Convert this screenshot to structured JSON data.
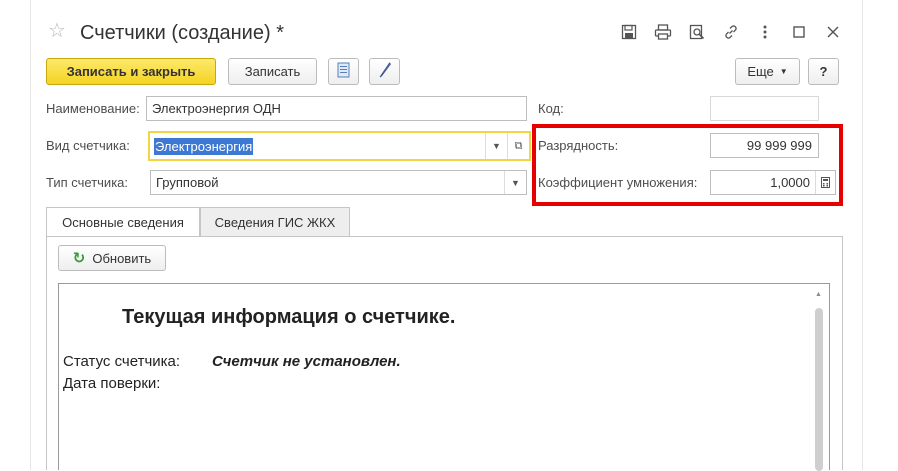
{
  "window": {
    "title": "Счетчики  (создание) *",
    "tools": [
      "save-icon",
      "print-icon",
      "preview-icon",
      "link-icon",
      "more-vertical-icon",
      "maximize-icon",
      "close-icon"
    ]
  },
  "toolbar": {
    "save_close_label": "Записать и закрыть",
    "save_label": "Записать",
    "more_label": "Еще",
    "help_label": "?"
  },
  "form": {
    "name_label": "Наименование:",
    "name_value": "Электроэнергия ОДН",
    "code_label": "Код:",
    "code_value": "",
    "type_label": "Вид счетчика:",
    "type_value": "Электроэнергия",
    "kind_label": "Тип счетчика:",
    "kind_value": "Групповой",
    "digits_label": "Разрядность:",
    "digits_value": "99 999 999",
    "coef_label": "Коэффициент умножения:",
    "coef_value": "1,0000"
  },
  "tabs": [
    {
      "label": "Основные сведения",
      "active": true
    },
    {
      "label": "Сведения ГИС ЖКХ",
      "active": false
    }
  ],
  "main": {
    "refresh_label": "Обновить",
    "info_title": "Текущая информация о счетчике.",
    "status_label": "Статус счетчика:",
    "status_value": "Счетчик не установлен.",
    "verify_label": "Дата поверки:"
  },
  "colors": {
    "primary_button": "#f5d323",
    "focus_border": "#f3d443",
    "highlight_box": "#e60000",
    "selection": "#3d78d3"
  }
}
